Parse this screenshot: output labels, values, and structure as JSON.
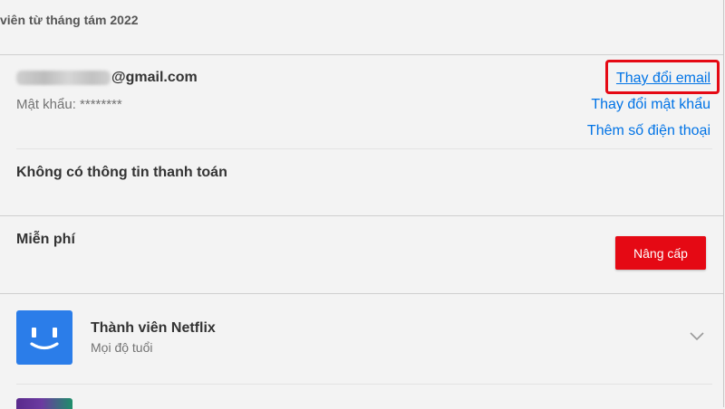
{
  "membership": {
    "since_text": "viên từ tháng tám 2022"
  },
  "account": {
    "email_domain": "@gmail.com",
    "password_label": "Mật khẩu: ********",
    "change_email_link": "Thay đổi email",
    "change_password_link": "Thay đổi mật khẩu",
    "add_phone_link": "Thêm số điện thoại",
    "highlight_color": "#e50914"
  },
  "billing": {
    "no_payment_info": "Không có thông tin thanh toán"
  },
  "plan": {
    "name": "Miễn phí",
    "upgrade_button": "Nâng cấp",
    "button_color": "#e50914"
  },
  "profiles": [
    {
      "name": "Thành viên Netflix",
      "rating": "Mọi độ tuổi",
      "avatar_color": "#2b7de9",
      "icon": "smiley-face-icon"
    }
  ],
  "colors": {
    "link": "#0073e6",
    "background": "#f3f3f3"
  }
}
